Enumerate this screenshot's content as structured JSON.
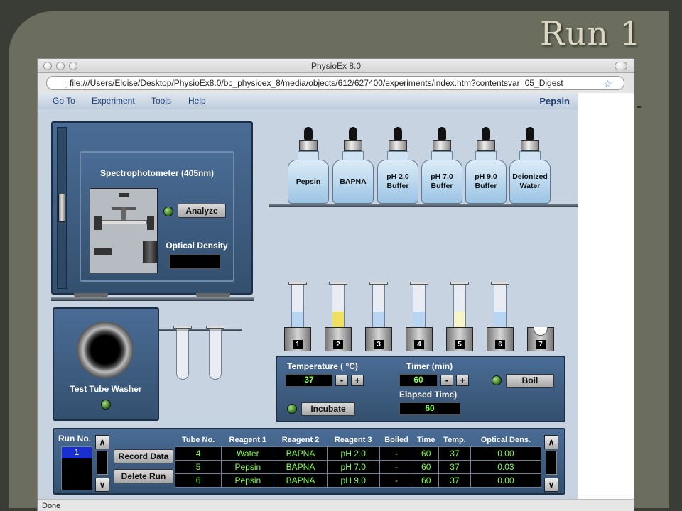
{
  "slide": {
    "title": "Run 1"
  },
  "window": {
    "title": "PhysioEx 8.0",
    "url": "file:///Users/Eloise/Desktop/PhysioEx8.0/bc_physioex_8/media/objects/612/627400/experiments/index.htm?contentsvar=05_Digest",
    "status": "Done"
  },
  "menu": {
    "items": [
      "Go To",
      "Experiment",
      "Tools",
      "Help"
    ],
    "app_name": "Pepsin"
  },
  "spectro": {
    "title": "Spectrophotometer (405nm)",
    "analyze": "Analyze",
    "od_label": "Optical Density",
    "od_value": ""
  },
  "bottles": [
    "Pepsin",
    "BAPNA",
    "pH 2.0\nBuffer",
    "pH 7.0\nBuffer",
    "pH 9.0\nBuffer",
    "Deionized\nWater"
  ],
  "tubes": [
    {
      "num": "1",
      "fill": 0.45,
      "color": "#b8d6f2"
    },
    {
      "num": "2",
      "fill": 0.45,
      "color": "#f0e060"
    },
    {
      "num": "3",
      "fill": 0.45,
      "color": "#b8d6f2"
    },
    {
      "num": "4",
      "fill": 0.45,
      "color": "#b8d6f2"
    },
    {
      "num": "5",
      "fill": 0.45,
      "color": "#f8f6c8"
    },
    {
      "num": "6",
      "fill": 0.45,
      "color": "#b8d6f2"
    },
    {
      "num": "7",
      "fill": 0,
      "color": "#b8d6f2"
    }
  ],
  "washer": {
    "label": "Test Tube Washer"
  },
  "controls": {
    "temp_label": "Temperature ( °C)",
    "temp_value": "37",
    "timer_label": "Timer (min)",
    "timer_value": "60",
    "boil": "Boil",
    "elapsed_label": "Elapsed Time)",
    "elapsed_value": "60",
    "incubate": "Incubate",
    "minus": "-",
    "plus": "+"
  },
  "data_panel": {
    "run_label": "Run No.",
    "run_value": "1",
    "record": "Record Data",
    "delete": "Delete Run",
    "up": "∧",
    "down": "∨",
    "headers": [
      "Tube No.",
      "Reagent 1",
      "Reagent 2",
      "Reagent 3",
      "Boiled",
      "Time",
      "Temp.",
      "Optical Dens."
    ],
    "rows": [
      [
        "4",
        "Water",
        "BAPNA",
        "pH 2.0",
        "-",
        "60",
        "37",
        "0.00"
      ],
      [
        "5",
        "Pepsin",
        "BAPNA",
        "pH 7.0",
        "-",
        "60",
        "37",
        "0.03"
      ],
      [
        "6",
        "Pepsin",
        "BAPNA",
        "pH 9.0",
        "-",
        "60",
        "37",
        "0.00"
      ]
    ]
  }
}
